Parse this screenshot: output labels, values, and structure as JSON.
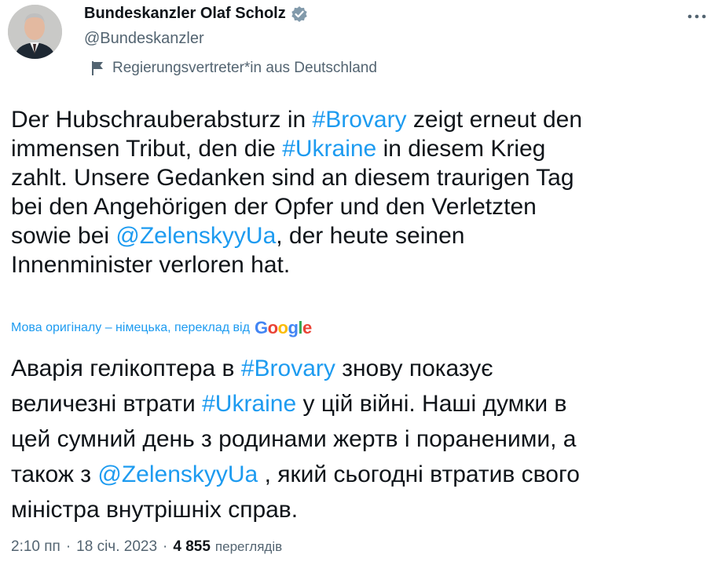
{
  "author": {
    "display_name": "Bundeskanzler Olaf Scholz",
    "handle": "@Bundeskanzler",
    "label": "Regierungsvertreter*in aus Deutschland"
  },
  "tweet": {
    "lines": [
      [
        {
          "t": "Der Hubschrauberabsturz in "
        },
        {
          "t": "#Brovary",
          "link": true
        },
        {
          "t": " zeigt erneut den"
        }
      ],
      [
        {
          "t": "immensen Tribut, den die "
        },
        {
          "t": "#Ukraine",
          "link": true
        },
        {
          "t": " in diesem Krieg"
        }
      ],
      [
        {
          "t": "zahlt. Unsere Gedanken sind an diesem traurigen Tag"
        }
      ],
      [
        {
          "t": "bei den Angehörigen der Opfer und den Verletzten"
        }
      ],
      [
        {
          "t": "sowie bei "
        },
        {
          "t": "@ZelenskyyUa",
          "link": true
        },
        {
          "t": ", der heute seinen"
        }
      ],
      [
        {
          "t": "Innenminister verloren hat."
        }
      ]
    ]
  },
  "translation": {
    "note": "Мова оригіналу – німецька, переклад від",
    "provider": "Google",
    "lines": [
      [
        {
          "t": "Аварія гелікоптера в "
        },
        {
          "t": "#Brovary",
          "link": true
        },
        {
          "t": " знову показує"
        }
      ],
      [
        {
          "t": "величезні втрати "
        },
        {
          "t": "#Ukraine",
          "link": true
        },
        {
          "t": " у цій війні. Наші думки в"
        }
      ],
      [
        {
          "t": "цей сумний день з родинами жертв і пораненими, а"
        }
      ],
      [
        {
          "t": "також з "
        },
        {
          "t": "@ZelenskyyUa",
          "link": true
        },
        {
          "t": " , який сьогодні втратив свого"
        }
      ],
      [
        {
          "t": "міністра внутрішніх справ."
        }
      ]
    ]
  },
  "meta": {
    "time": "2:10 пп",
    "separator": "·",
    "date": "18 січ. 2023",
    "views_count": "4 855",
    "views_label": "переглядів"
  },
  "colors": {
    "link": "#1d9bf0",
    "verified": "#829aab",
    "text": "#0f1419",
    "secondary": "#536471"
  },
  "icons": {
    "verified": "verified-badge-icon",
    "label": "flag-icon",
    "more": "more-dots-icon"
  }
}
